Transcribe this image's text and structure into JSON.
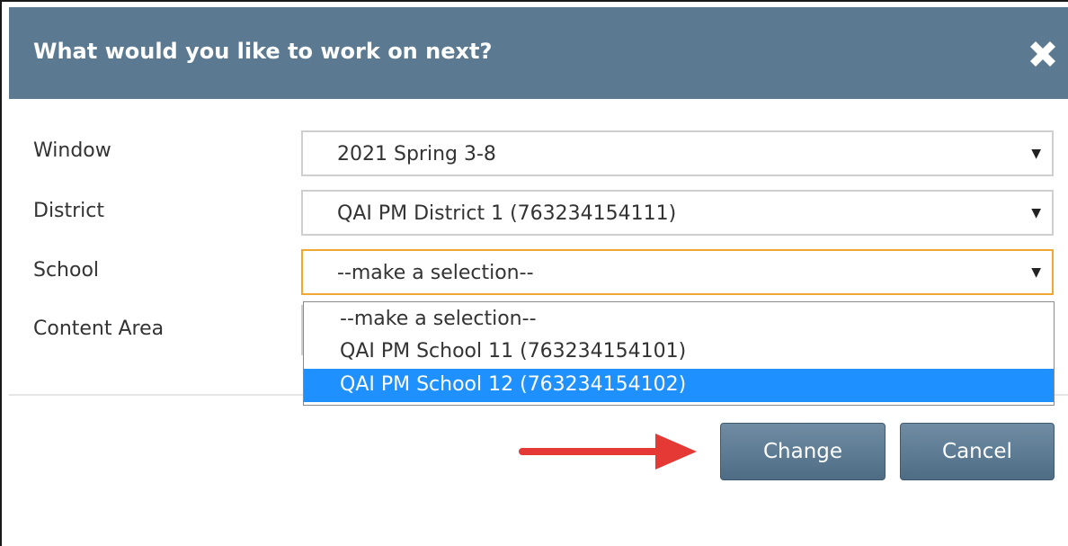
{
  "dialog": {
    "title": "What would you like to work on next?",
    "close_icon": "close-x-icon"
  },
  "fields": {
    "window": {
      "label": "Window",
      "value": "2021 Spring 3-8"
    },
    "district": {
      "label": "District",
      "value": "QAI PM District 1 (763234154111)"
    },
    "school": {
      "label": "School",
      "value": "--make a selection--"
    },
    "content_area": {
      "label": "Content Area"
    }
  },
  "school_dropdown": {
    "options": [
      "--make a selection--",
      "QAI PM School 11 (763234154101)",
      "QAI PM School 12 (763234154102)"
    ],
    "highlighted_index": 2
  },
  "caret_glyph": "▼",
  "buttons": {
    "change": "Change",
    "cancel": "Cancel"
  },
  "colors": {
    "header_bg": "#5b7a92",
    "focus_border": "#f0a733",
    "highlight_bg": "#1e90ff",
    "annotation_arrow": "#e53935"
  }
}
